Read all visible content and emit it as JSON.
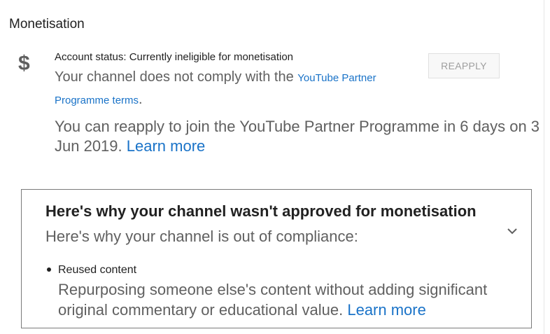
{
  "section": {
    "title": "Monetisation"
  },
  "status": {
    "icon": "dollar-icon",
    "icon_glyph": "$",
    "account_status": "Account status: Currently ineligible for monetisation",
    "comply_text": "Your channel does not comply with the",
    "terms_link": "YouTube Partner Programme terms",
    "comply_end": ".",
    "reapply_text": "You can reapply to join the YouTube Partner Programme in 6 days on 3 Jun 2019.",
    "learn_more": "Learn more",
    "reapply_button": "REAPPLY"
  },
  "reasons_panel": {
    "title": "Here's why your channel wasn't approved for monetisation",
    "subtitle": "Here's why your channel is out of compliance:",
    "expand_icon": "chevron-down-icon",
    "items": [
      {
        "title": "Reused content",
        "description": "Repurposing someone else's content without adding significant original commentary or educational value.",
        "learn_more": "Learn more"
      }
    ]
  },
  "colors": {
    "link": "#1a73c8",
    "primary_text": "#212121",
    "secondary_text": "#606060",
    "disabled_button_text": "#9e9e9e",
    "panel_border": "#7a7a7a"
  }
}
